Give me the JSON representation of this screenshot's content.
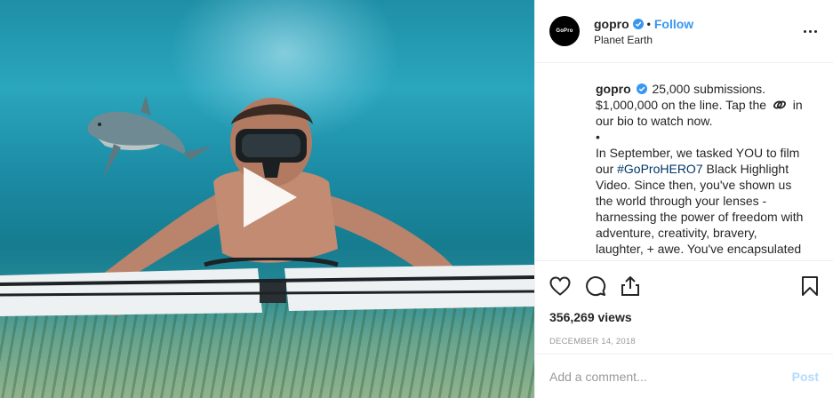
{
  "account": {
    "username": "gopro",
    "avatar_text": "GoPro",
    "follow_label": "Follow",
    "separator": "•",
    "location": "Planet Earth"
  },
  "caption": {
    "username": "gopro",
    "lines": [
      "25,000 submissions.",
      "$1,000,000 on the line. Tap the",
      "our bio to watch now.",
      "•",
      "In September, we tasked YOU to film",
      "our",
      "#GoProHERO7",
      "Black Highlight",
      "Video. Since then, you've shown us",
      "the world through your lenses -",
      "harnessing the power of freedom with",
      "adventure, creativity, bravery,",
      "laughter, + awe. You've encapsulated"
    ],
    "link_emoji_after": "in"
  },
  "stats": {
    "views": "356,269 views",
    "date": "DECEMBER 14, 2018"
  },
  "comment": {
    "placeholder": "Add a comment...",
    "post_label": "Post"
  },
  "colors": {
    "link": "#3897f0",
    "hashtag": "#003569",
    "verified": "#3897f0",
    "post_disabled": "#b3dbff"
  },
  "icons": [
    "heart-icon",
    "comment-icon",
    "share-icon",
    "bookmark-icon",
    "more-icon",
    "play-icon",
    "verified-badge-icon",
    "link-icon"
  ]
}
